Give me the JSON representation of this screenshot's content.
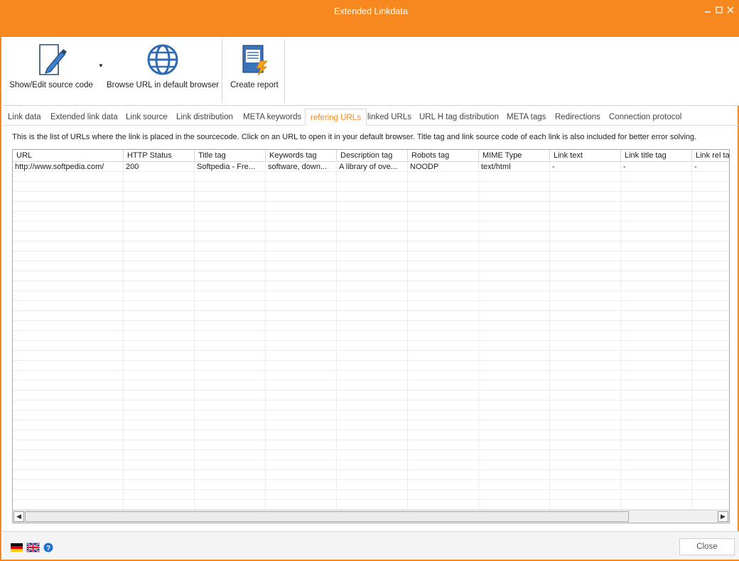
{
  "window": {
    "title": "Extended Linkdata"
  },
  "ribbon": {
    "show_edit_label": "Show/Edit source code",
    "browse_label": "Browse URL in default browser",
    "report_label": "Create report"
  },
  "tabs": [
    "Link data",
    "Extended link data",
    "Link source",
    "Link distribution",
    "META keywords",
    "refering URLs",
    "linked URLs",
    "URL H tag distribution",
    "META tags",
    "Redirections",
    "Connection protocol"
  ],
  "active_tab": "refering URLs",
  "description": "This is the list of URLs where the link is placed in the sourcecode. Click on an URL to open it in your default browser. Title tag and link source code of each link is also included for better error solving.",
  "grid": {
    "columns": [
      "URL",
      "HTTP Status",
      "Title tag",
      "Keywords tag",
      "Description tag",
      "Robots tag",
      "MIME Type",
      "Link text",
      "Link title tag",
      "Link rel tag"
    ],
    "rows": [
      [
        "http://www.softpedia.com/",
        "200",
        "Softpedia - Fre...",
        "software, down...",
        "A library of ove...",
        "NOODP",
        "text/html",
        "-",
        "-",
        "-"
      ]
    ]
  },
  "footer": {
    "close_label": "Close"
  },
  "colors": {
    "accent": "#f7881f"
  },
  "icons": [
    "minimize-icon",
    "maximize-icon",
    "close-icon",
    "edit-document-icon",
    "globe-icon",
    "report-icon",
    "german-flag-icon",
    "uk-flag-icon",
    "help-icon"
  ]
}
